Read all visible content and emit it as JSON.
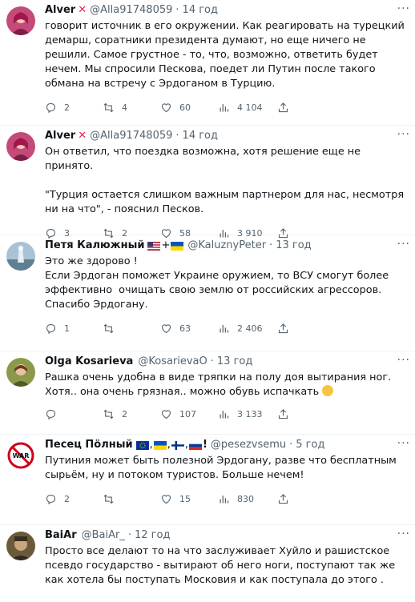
{
  "tweets": [
    {
      "name": "Alver",
      "handle": "@Alla91748059",
      "time": "14 год",
      "text": "говорит источник в его окружении. Как реагировать на турецкий демарш, соратники президента думают, но еще ничего не решили. Самое грустное - то, что, возможно, ответить будет нечем. Мы спросили Пескова, поедет ли Путин после такого обмана на встречу с Эрдоганом в Турцию.",
      "replies": "2",
      "retweets": "4",
      "likes": "60",
      "views": "4 104"
    },
    {
      "name": "Alver",
      "handle": "@Alla91748059",
      "time": "14 год",
      "text": "Он ответил, что поездка возможна, хотя решение еще не принято.\n\n\"Турция остается слишком важным партнером для нас, несмотря ни на что\", - пояснил Песков.",
      "replies": "3",
      "retweets": "2",
      "likes": "58",
      "views": "3 910"
    },
    {
      "name": "Петя Калюжный",
      "name_suffix": "+",
      "handle": "@KaluznyPeter",
      "time": "13 год",
      "text": "Это же здорово !\nЕсли Эрдоган поможет Украине оружием, то ВСУ смогут более эффективно  очищать свою землю от российских агрессоров.\nСпасибо Эрдогану.",
      "replies": "1",
      "retweets": "",
      "likes": "63",
      "views": "2 406"
    },
    {
      "name": "Olga Kosarieva",
      "handle": "@KosarievaO",
      "time": "13 год",
      "text": "Рашка очень удобна в виде тряпки на полу доя вытирания ног. Хотя.. она очень грязная.. можно обувь испачкать",
      "replies": "",
      "retweets": "2",
      "likes": "107",
      "views": "3 133"
    },
    {
      "name": "Песец Пöлный",
      "name_suffix": ",  ,  ,  !",
      "handle": "@pesezvsemu",
      "time": "5 год",
      "text": "Путиния может быть полезной Эрдогану, разве что бесплатным сырьём, ну и потоком туристов. Больше нечем!",
      "replies": "2",
      "retweets": "",
      "likes": "15",
      "views": "830",
      "avatar_text": "WAR"
    },
    {
      "name": "BaiAr",
      "handle": "@BaiAr_",
      "time": "12 год",
      "text": "Просто все делают то на что заслуживает Хуйло и рашистское псевдо государство - вытирают об него ноги, поступают так же как хотела бы поступать Московия и как поступала до этого ."
    }
  ],
  "colors": {
    "accent": "#e0245e",
    "muted": "#536471",
    "text": "#0f1419"
  }
}
